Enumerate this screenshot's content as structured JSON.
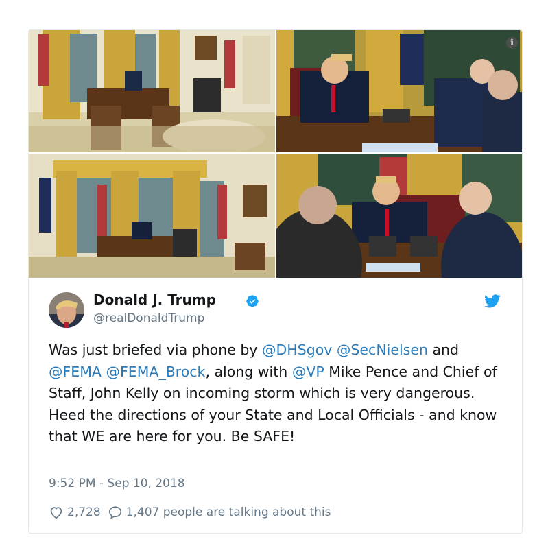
{
  "tweet": {
    "author_name": "Donald J. Trump",
    "handle": "@realDonaldTrump",
    "text_parts": [
      {
        "text": "Was just briefed via phone by "
      },
      {
        "text": "@DHSgov",
        "mention": true
      },
      {
        "text": " "
      },
      {
        "text": "@SecNielsen",
        "mention": true
      },
      {
        "text": " and "
      },
      {
        "text": "@FEMA",
        "mention": true
      },
      {
        "text": " "
      },
      {
        "text": "@FEMA_Brock",
        "mention": true
      },
      {
        "text": ", along with "
      },
      {
        "text": "@VP",
        "mention": true
      },
      {
        "text": " Mike Pence and Chief of Staff, John Kelly on incoming storm which is very dangerous. Heed the directions of your State and Local Officials - and know that WE are here for you. Be SAFE!"
      }
    ],
    "timestamp": "9:52 PM - Sep 10, 2018",
    "like_count": "2,728",
    "conversation_text": "1,407 people are talking about this"
  },
  "photos": {
    "count": 4,
    "info_icon": "info-icon"
  },
  "colors": {
    "link": "#2b7bb9",
    "twitter_blue": "#1da1f2",
    "secondary_text": "#657786",
    "border": "#e1e8ed"
  },
  "icons": {
    "verified": "verified-badge-icon",
    "brand": "twitter-bird-icon",
    "like": "heart-icon",
    "reply": "speech-bubble-icon"
  }
}
